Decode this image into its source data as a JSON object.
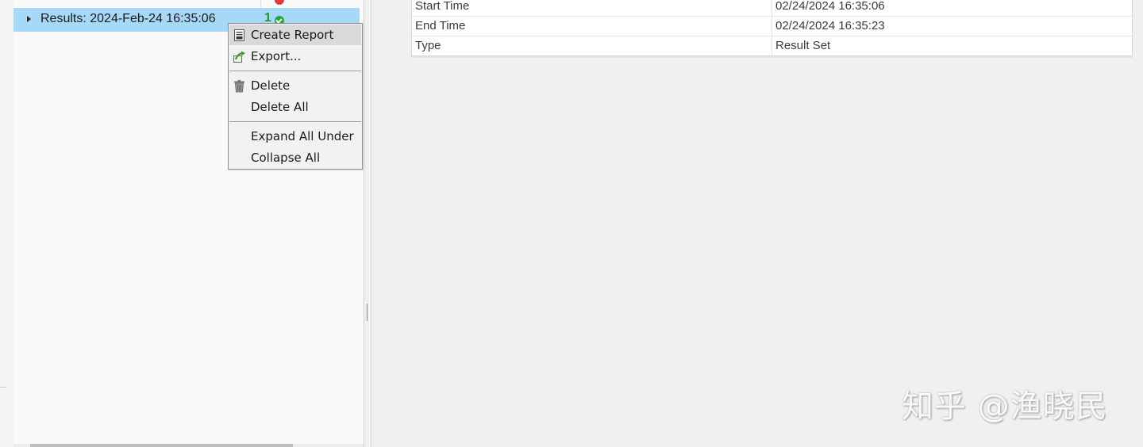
{
  "tree": {
    "selected_row": {
      "label": "Results: 2024-Feb-24 16:35:06",
      "pass_count": "1"
    }
  },
  "properties": {
    "rows": [
      {
        "key": "Start Time",
        "value": "02/24/2024 16:35:06"
      },
      {
        "key": "End Time",
        "value": "02/24/2024 16:35:23"
      },
      {
        "key": "Type",
        "value": "Result Set"
      }
    ]
  },
  "context_menu": {
    "items": [
      {
        "label": "Create Report",
        "icon": "report-icon"
      },
      {
        "label": "Export...",
        "icon": "export-icon"
      },
      {
        "label": "Delete",
        "icon": "trash-icon"
      },
      {
        "label": "Delete All",
        "icon": ""
      },
      {
        "label": "Expand All Under",
        "icon": ""
      },
      {
        "label": "Collapse All",
        "icon": ""
      }
    ]
  },
  "watermark": "知乎 @渔晓民",
  "colors": {
    "selection": "#a6d8f8",
    "pass_green": "#1e9a2e",
    "fail_red": "#e03a3a",
    "menu_hover": "#d9d9d9"
  }
}
